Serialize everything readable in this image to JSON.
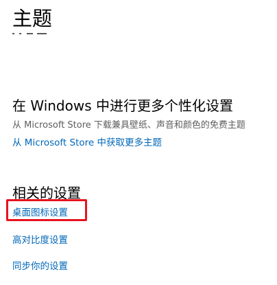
{
  "page": {
    "title": "主题"
  },
  "store_section": {
    "heading": "在 Windows 中进行更多个性化设置",
    "description": "从 Microsoft Store 下载兼具壁纸、声音和颜色的免费主题",
    "link": "从 Microsoft Store 中获取更多主题"
  },
  "related_settings": {
    "heading": "相关的设置",
    "links": [
      "桌面图标设置",
      "高对比度设置",
      "同步你的设置"
    ]
  },
  "colors": {
    "link": "#0067b8",
    "highlight": "#e8121f",
    "description": "#5d5d5d"
  }
}
